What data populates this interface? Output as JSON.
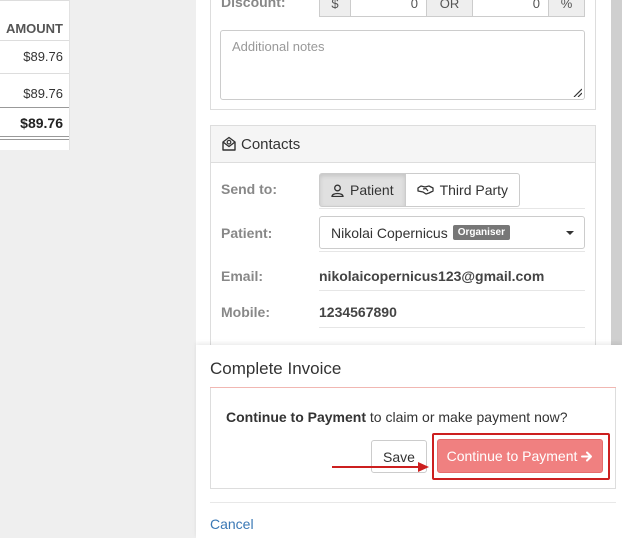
{
  "invoice_table": {
    "header": "AMOUNT",
    "rows": [
      "$89.76",
      "$89.76"
    ],
    "total": "$89.76"
  },
  "discount": {
    "label": "Discount:",
    "currency_symbol": "$",
    "amount_value": "0",
    "or_label": "OR",
    "percent_value": "0",
    "percent_symbol": "%"
  },
  "notes": {
    "placeholder": "Additional notes"
  },
  "contacts": {
    "title": "Contacts",
    "send_to_label": "Send to:",
    "send_options": [
      {
        "label": "Patient",
        "icon": "user-icon",
        "active": true
      },
      {
        "label": "Third Party",
        "icon": "handshake-icon",
        "active": false
      }
    ],
    "patient_label": "Patient:",
    "patient_value": "Nikolai Copernicus",
    "patient_badge": "Organiser",
    "email_label": "Email:",
    "email_value": "nikolaicopernicus123@gmail.com",
    "mobile_label": "Mobile:",
    "mobile_value": "1234567890"
  },
  "complete_invoice": {
    "title": "Complete Invoice",
    "message_bold": "Continue to Payment",
    "message_rest": " to claim or make payment now?",
    "save_label": "Save",
    "pay_label": "Continue to Payment",
    "cancel_label": "Cancel",
    "accent_color": "#f08080",
    "highlight_color": "#cc1f1f"
  }
}
